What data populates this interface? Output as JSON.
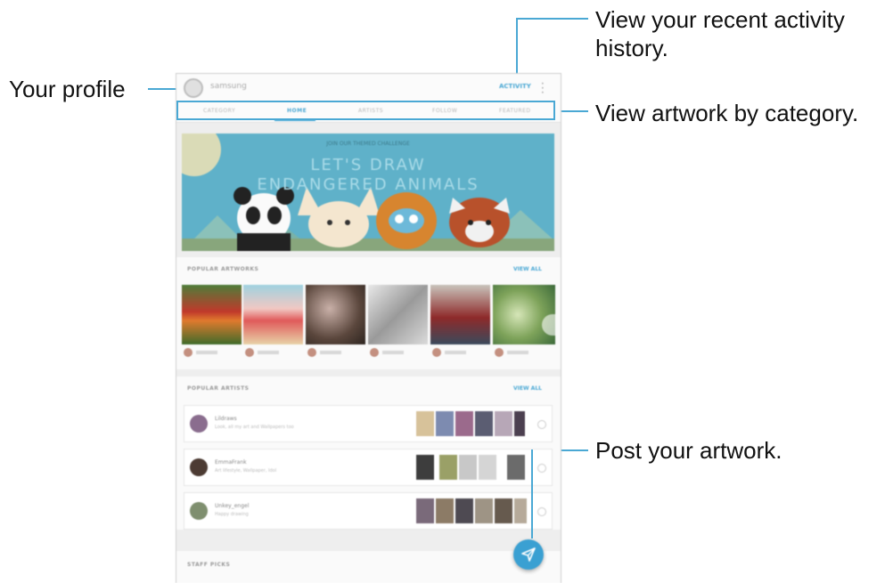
{
  "callouts": {
    "profile": "Your profile",
    "activity_line1": "View your recent activity",
    "activity_line2": "history.",
    "category": "View artwork by category.",
    "post": "Post your artwork."
  },
  "app": {
    "username": "samsung",
    "activity_button": "ACTIVITY",
    "tabs": [
      "CATEGORY",
      "HOME",
      "ARTISTS",
      "FOLLOW",
      "FEATURED"
    ],
    "active_tab": "HOME",
    "banner_title": "JOIN OUR THEMED CHALLENGE",
    "banner_headline_1": "LET'S DRAW",
    "banner_headline_2": "ENDANGERED ANIMALS",
    "popular_artworks": {
      "title": "POPULAR ARTWORKS",
      "view_all": "VIEW ALL"
    },
    "popular_artists": {
      "title": "POPULAR ARTISTS",
      "view_all": "VIEW ALL",
      "artists": [
        {
          "name": "Lildraws",
          "desc": "Look, all my art and Wallpapers too"
        },
        {
          "name": "EmmaFrank",
          "desc": "Art lifestyle, Wallpaper, Idol"
        },
        {
          "name": "Unkey_engel",
          "desc": "Happy drawing"
        }
      ]
    },
    "staff_picks": {
      "title": "STAFF PICKS"
    }
  },
  "colors": {
    "accent": "#4aa8d4",
    "fab": "#3aa0d2",
    "banner": "#5fb1c9"
  },
  "icons": {
    "fab": "send-icon",
    "menu": "more-vertical-icon",
    "link": "link-icon"
  }
}
